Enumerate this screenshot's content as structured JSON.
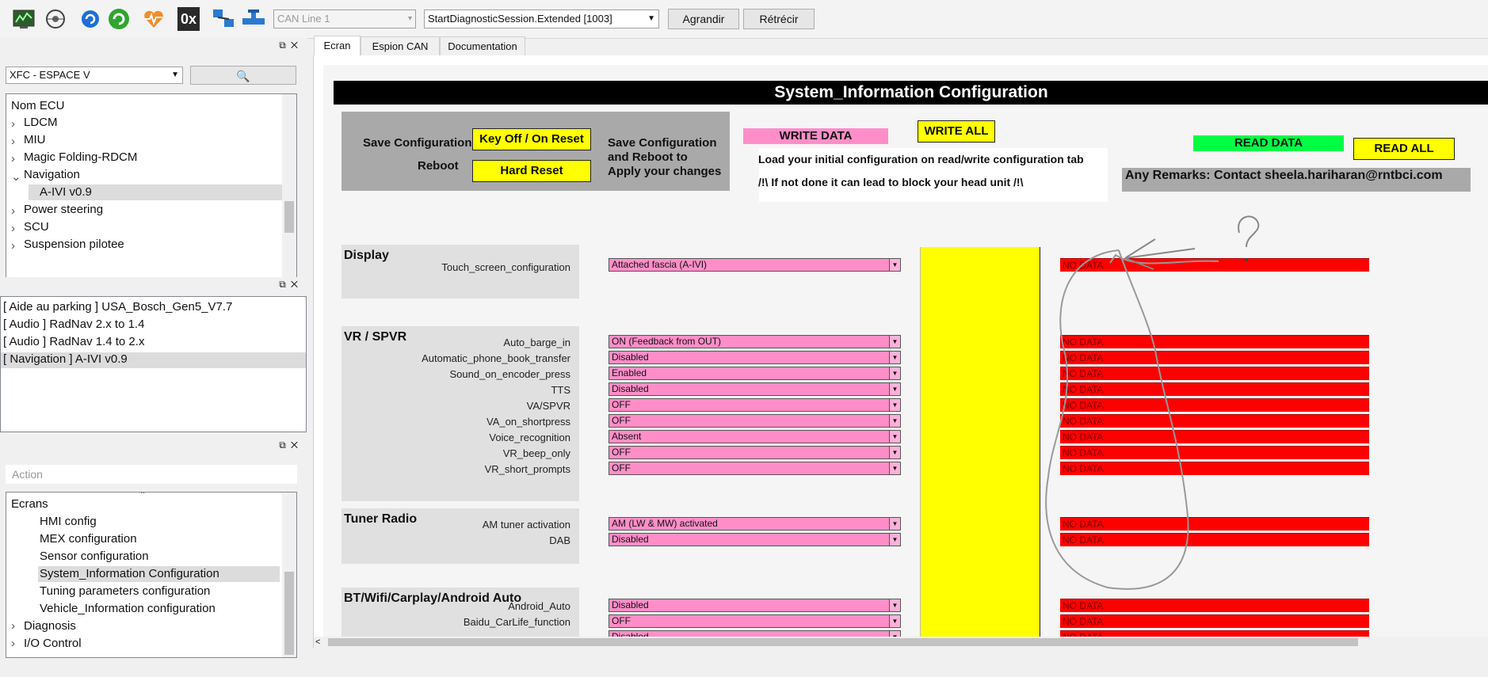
{
  "toolbar": {
    "icons": [
      "monitor-chart-icon",
      "globe-gear-icon",
      "refresh-blue-icon",
      "refresh-green-icon",
      "heart-pulse-icon",
      "hex-0x-icon",
      "network-settings-icon",
      "pipe-valve-icon"
    ],
    "hex_label": "0x",
    "can_line": "CAN Line 1",
    "session": "StartDiagnosticSession.Extended [1003]",
    "grow_label": "Agrandir",
    "shrink_label": "Rétrécir"
  },
  "ecu_panel": {
    "vehicle": "XFC - ESPACE V",
    "header": "Nom ECU",
    "items": [
      {
        "label": "LDCM",
        "level": 0,
        "expand": "right"
      },
      {
        "label": "MIU",
        "level": 0,
        "expand": "right"
      },
      {
        "label": "Magic Folding-RDCM",
        "level": 0,
        "expand": "right"
      },
      {
        "label": "Navigation",
        "level": 0,
        "expand": "down"
      },
      {
        "label": "A-IVI v0.9",
        "level": 1,
        "selected": true
      },
      {
        "label": "Power steering",
        "level": 0,
        "expand": "right"
      },
      {
        "label": "SCU",
        "level": 0,
        "expand": "right"
      },
      {
        "label": "Suspension pilotee",
        "level": 0,
        "expand": "right"
      }
    ]
  },
  "recent_panel": {
    "items": [
      "[ Aide au parking ] USA_Bosch_Gen5_V7.7",
      "[ Audio ] RadNav 2.x to 1.4",
      "[ Audio ] RadNav 1.4 to 2.x",
      "[ Navigation ] A-IVI v0.9"
    ]
  },
  "action_panel": {
    "placeholder": "Action",
    "root": "Ecrans",
    "items": [
      {
        "label": "HMI config",
        "level": 1
      },
      {
        "label": "MEX configuration",
        "level": 1
      },
      {
        "label": "Sensor configuration",
        "level": 1
      },
      {
        "label": "System_Information Configuration",
        "level": 1,
        "selected": true
      },
      {
        "label": "Tuning parameters configuration",
        "level": 1
      },
      {
        "label": "Vehicle_Information configuration",
        "level": 1
      },
      {
        "label": "Diagnosis",
        "level": 0,
        "expand": "right"
      },
      {
        "label": "I/O Control",
        "level": 0,
        "expand": "right"
      }
    ]
  },
  "tabs": [
    "Ecran",
    "Espion CAN",
    "Documentation"
  ],
  "sheet": {
    "title": "System_Information Configuration",
    "save_config": "Save Configuration",
    "reboot": "Reboot",
    "key_off": "Key Off / On Reset",
    "hard_reset": "Hard Reset",
    "save_note": [
      "Save Configuration",
      "and Reboot to",
      "Apply your changes"
    ],
    "write_data": "WRITE DATA",
    "write_all": "WRITE ALL",
    "load_note": "Load your initial configuration on read/write configuration tab",
    "warn_note": "/!\\ If not done it can lead to block your head unit /!\\",
    "read_data": "READ DATA",
    "read_all": "READ ALL",
    "remarks": "Any Remarks: Contact sheela.hariharan@rntbci.com",
    "no_data": "NO DATA",
    "annotation": "?",
    "sections": [
      {
        "title": "Display",
        "rows": [
          {
            "label": "Touch_screen_configuration",
            "value": "Attached fascia (A-IVI)"
          }
        ]
      },
      {
        "title": "VR / SPVR",
        "rows": [
          {
            "label": "Auto_barge_in",
            "value": "ON (Feedback from OUT)"
          },
          {
            "label": "Automatic_phone_book_transfer",
            "value": "Disabled"
          },
          {
            "label": "Sound_on_encoder_press",
            "value": "Enabled"
          },
          {
            "label": "TTS",
            "value": "Disabled"
          },
          {
            "label": "VA/SPVR",
            "value": "OFF"
          },
          {
            "label": "VA_on_shortpress",
            "value": "OFF"
          },
          {
            "label": "Voice_recognition",
            "value": "Absent"
          },
          {
            "label": "VR_beep_only",
            "value": "OFF"
          },
          {
            "label": "VR_short_prompts",
            "value": "OFF"
          }
        ]
      },
      {
        "title": "Tuner Radio",
        "rows": [
          {
            "label": "AM tuner activation",
            "value": "AM (LW & MW) activated"
          },
          {
            "label": "DAB",
            "value": "Disabled"
          }
        ]
      },
      {
        "title": "BT/Wifi/Carplay/Android Auto",
        "rows": [
          {
            "label": "Android_Auto",
            "value": "Disabled"
          },
          {
            "label": "Baidu_CarLife_function",
            "value": "OFF"
          },
          {
            "label": "",
            "value": "Disabled"
          }
        ]
      }
    ]
  },
  "colors": {
    "pink": "#ff8ec8",
    "red": "#ff0000",
    "yellow": "#ffff00",
    "green": "#00ff44",
    "black_bar": "#000000"
  }
}
